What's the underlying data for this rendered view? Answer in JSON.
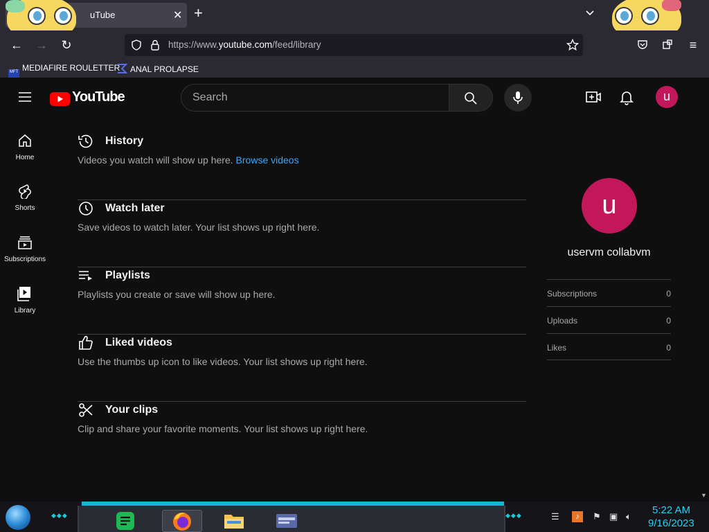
{
  "browser": {
    "tab_title": "uTube",
    "url_prefix": "https://www.",
    "url_domain": "youtube.com",
    "url_path": "/feed/library",
    "bookmarks": [
      {
        "label": "MEDIAFIRE ROULETTER",
        "icon_text": "MFT"
      },
      {
        "label": "ANAL PROLAPSE"
      }
    ]
  },
  "yt": {
    "logo_text": "YouTube",
    "search_placeholder": "Search",
    "avatar_letter": "u",
    "sidebar": [
      {
        "label": "Home"
      },
      {
        "label": "Shorts"
      },
      {
        "label": "Subscriptions"
      },
      {
        "label": "Library"
      }
    ],
    "sections": [
      {
        "title": "History",
        "desc": "Videos you watch will show up here.",
        "link": "Browse videos"
      },
      {
        "title": "Watch later",
        "desc": "Save videos to watch later. Your list shows up right here."
      },
      {
        "title": "Playlists",
        "desc": "Playlists you create or save will show up here."
      },
      {
        "title": "Liked videos",
        "desc": "Use the thumbs up icon to like videos. Your list shows up right here."
      },
      {
        "title": "Your clips",
        "desc": "Clip and share your favorite moments. Your list shows up right here."
      }
    ],
    "profile": {
      "letter": "u",
      "name": "uservm collabvm",
      "stats": [
        {
          "label": "Subscriptions",
          "value": "0"
        },
        {
          "label": "Uploads",
          "value": "0"
        },
        {
          "label": "Likes",
          "value": "0"
        }
      ]
    },
    "colors": {
      "accent": "#ff0000",
      "avatar": "#c2185b",
      "link": "#3ea6ff"
    }
  },
  "taskbar": {
    "time": "5:22 AM",
    "date": "9/16/2023"
  }
}
